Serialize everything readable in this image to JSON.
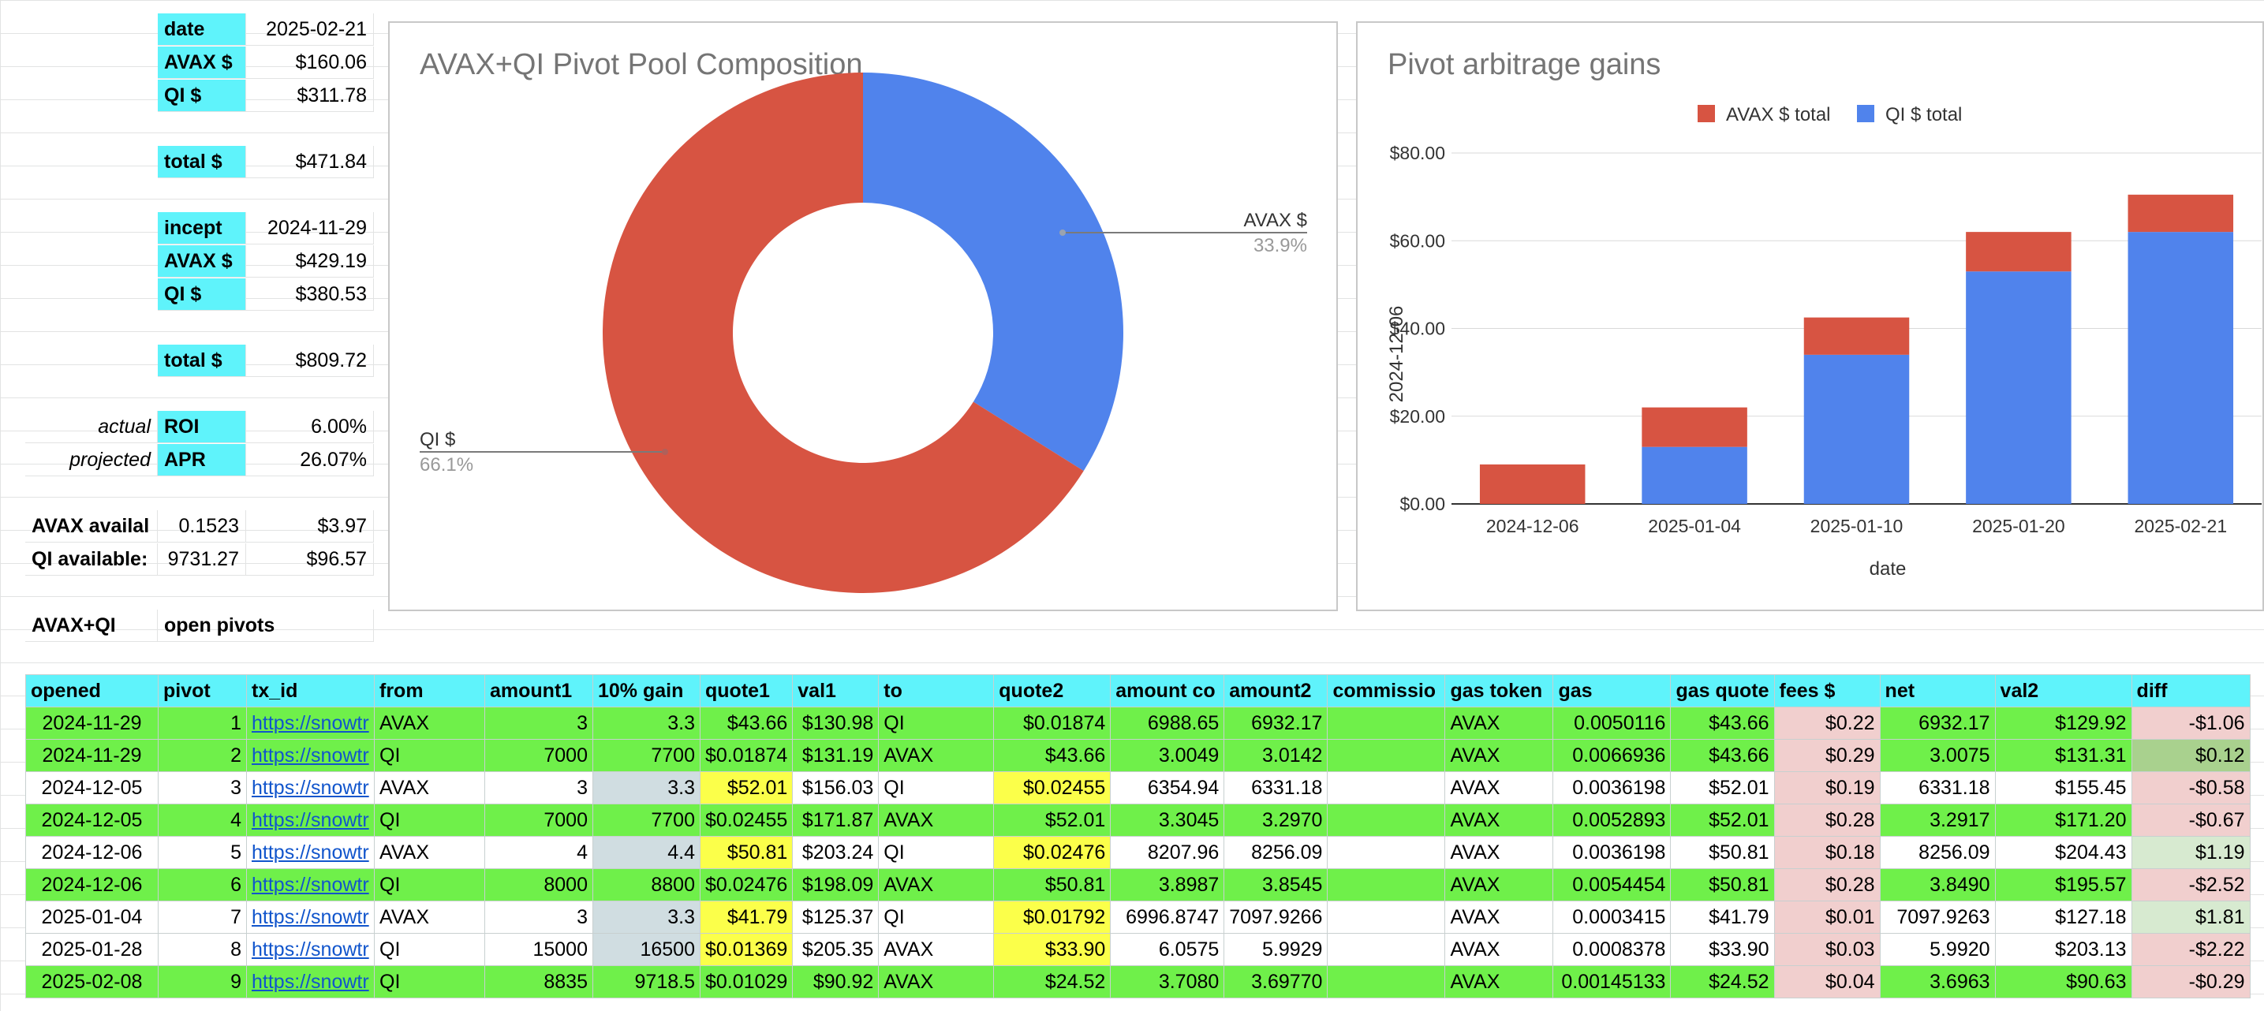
{
  "summary": {
    "date_label": "date",
    "date_value": "2025-02-21",
    "avax_label": "AVAX $",
    "avax_value": "$160.06",
    "qi_label": "QI $",
    "qi_value": "$311.78",
    "total_label": "total $",
    "total_value": "$471.84",
    "incept_label": "incept",
    "incept_value": "2024-11-29",
    "avax2_label": "AVAX $",
    "avax2_value": "$429.19",
    "qi2_label": "QI $",
    "qi2_value": "$380.53",
    "total2_label": "total $",
    "total2_value": "$809.72",
    "actual_label": "actual",
    "roi_label": "ROI",
    "roi_value": "6.00%",
    "projected_label": "projected",
    "apr_label": "APR",
    "apr_value": "26.07%",
    "avax_avail_label": "AVAX availal",
    "avax_avail_qty": "0.1523",
    "avax_avail_usd": "$3.97",
    "qi_avail_label": "QI available:",
    "qi_avail_qty": "9731.27",
    "qi_avail_usd": "$96.57",
    "pair_label": "AVAX+QI",
    "open_pivots_label": "open pivots"
  },
  "pie_chart": {
    "title": "AVAX+QI Pivot Pool Composition",
    "slices": [
      {
        "name": "AVAX $",
        "pct_label": "33.9%",
        "value": 33.9,
        "color": "#5083ec"
      },
      {
        "name": "QI $",
        "pct_label": "66.1%",
        "value": 66.1,
        "color": "#d75442"
      }
    ]
  },
  "chart_data": {
    "type": "bar",
    "title": "Pivot arbitrage gains",
    "xlabel": "date",
    "ylabel": "2024-12-06",
    "categories": [
      "2024-12-06",
      "2025-01-04",
      "2025-01-10",
      "2025-01-20",
      "2025-02-21"
    ],
    "series": [
      {
        "name": "QI $ total",
        "color": "#5083ec",
        "values": [
          0,
          13,
          34,
          53,
          62
        ]
      },
      {
        "name": "AVAX $ total",
        "color": "#d75442",
        "values": [
          9,
          9,
          8.5,
          9,
          8.5
        ]
      }
    ],
    "stacked": true,
    "ylim": [
      0,
      80
    ],
    "yticks": [
      "$0.00",
      "$20.00",
      "$40.00",
      "$60.00",
      "$80.00"
    ],
    "ytick_values": [
      0,
      20,
      40,
      60,
      80
    ],
    "legend": [
      "AVAX $ total",
      "QI $ total"
    ],
    "legend_position": "top",
    "grid": true
  },
  "table": {
    "headers": [
      "opened",
      "pivot",
      "tx_id",
      "from",
      "amount1",
      "10% gain",
      "quote1",
      "val1",
      "to",
      "quote2",
      "amount co",
      "amount2",
      "commissio",
      "gas token",
      "gas",
      "gas quote",
      "fees $",
      "net",
      "val2",
      "diff"
    ],
    "rows": [
      {
        "style": "green",
        "cells": [
          "2024-11-29",
          "1",
          "https://snowtr",
          "AVAX",
          "3",
          "3.3",
          "$43.66",
          "$130.98",
          "QI",
          "$0.01874",
          "6988.65",
          "6932.17",
          "",
          "AVAX",
          "0.0050116",
          "$43.66",
          "$0.22",
          "6932.17",
          "$129.92",
          "-$1.06"
        ],
        "diff": "neg",
        "q1": "",
        "q2": "",
        "g": ""
      },
      {
        "style": "green",
        "cells": [
          "2024-11-29",
          "2",
          "https://snowtr",
          "QI",
          "7000",
          "7700",
          "$0.01874",
          "$131.19",
          "AVAX",
          "$43.66",
          "3.0049",
          "3.0142",
          "",
          "AVAX",
          "0.0066936",
          "$43.66",
          "$0.29",
          "3.0075",
          "$131.31",
          "$0.12"
        ],
        "diff": "pos2",
        "q1": "",
        "q2": "",
        "g": ""
      },
      {
        "style": "white",
        "cells": [
          "2024-12-05",
          "3",
          "https://snowtr",
          "AVAX",
          "3",
          "3.3",
          "$52.01",
          "$156.03",
          "QI",
          "$0.02455",
          "6354.94",
          "6331.18",
          "",
          "AVAX",
          "0.0036198",
          "$52.01",
          "$0.19",
          "6331.18",
          "$155.45",
          "-$0.58"
        ],
        "diff": "neg",
        "q1": "yellow",
        "q2": "yellow",
        "g": "grey"
      },
      {
        "style": "green",
        "cells": [
          "2024-12-05",
          "4",
          "https://snowtr",
          "QI",
          "7000",
          "7700",
          "$0.02455",
          "$171.87",
          "AVAX",
          "$52.01",
          "3.3045",
          "3.2970",
          "",
          "AVAX",
          "0.0052893",
          "$52.01",
          "$0.28",
          "3.2917",
          "$171.20",
          "-$0.67"
        ],
        "diff": "neg",
        "q1": "",
        "q2": "",
        "g": ""
      },
      {
        "style": "white",
        "cells": [
          "2024-12-06",
          "5",
          "https://snowtr",
          "AVAX",
          "4",
          "4.4",
          "$50.81",
          "$203.24",
          "QI",
          "$0.02476",
          "8207.96",
          "8256.09",
          "",
          "AVAX",
          "0.0036198",
          "$50.81",
          "$0.18",
          "8256.09",
          "$204.43",
          "$1.19"
        ],
        "diff": "pos",
        "q1": "yellow",
        "q2": "yellow",
        "g": "grey"
      },
      {
        "style": "green",
        "cells": [
          "2024-12-06",
          "6",
          "https://snowtr",
          "QI",
          "8000",
          "8800",
          "$0.02476",
          "$198.09",
          "AVAX",
          "$50.81",
          "3.8987",
          "3.8545",
          "",
          "AVAX",
          "0.0054454",
          "$50.81",
          "$0.28",
          "3.8490",
          "$195.57",
          "-$2.52"
        ],
        "diff": "neg",
        "q1": "",
        "q2": "",
        "g": ""
      },
      {
        "style": "white",
        "cells": [
          "2025-01-04",
          "7",
          "https://snowtr",
          "AVAX",
          "3",
          "3.3",
          "$41.79",
          "$125.37",
          "QI",
          "$0.01792",
          "6996.8747",
          "7097.9266",
          "",
          "AVAX",
          "0.0003415",
          "$41.79",
          "$0.01",
          "7097.9263",
          "$127.18",
          "$1.81"
        ],
        "diff": "pos",
        "q1": "yellow",
        "q2": "yellow",
        "g": "grey"
      },
      {
        "style": "white",
        "cells": [
          "2025-01-28",
          "8",
          "https://snowtr",
          "QI",
          "15000",
          "16500",
          "$0.01369",
          "$205.35",
          "AVAX",
          "$33.90",
          "6.0575",
          "5.9929",
          "",
          "AVAX",
          "0.0008378",
          "$33.90",
          "$0.03",
          "5.9920",
          "$203.13",
          "-$2.22"
        ],
        "diff": "neg",
        "q1": "yellow",
        "q2": "yellow",
        "g": "grey"
      },
      {
        "style": "green",
        "cells": [
          "2025-02-08",
          "9",
          "https://snowtr",
          "QI",
          "8835",
          "9718.5",
          "$0.01029",
          "$90.92",
          "AVAX",
          "$24.52",
          "3.7080",
          "3.69770",
          "",
          "AVAX",
          "0.00145133",
          "$24.52",
          "$0.04",
          "3.6963",
          "$90.63",
          "-$0.29"
        ],
        "diff": "neg",
        "q1": "",
        "q2": "",
        "g": ""
      }
    ]
  }
}
